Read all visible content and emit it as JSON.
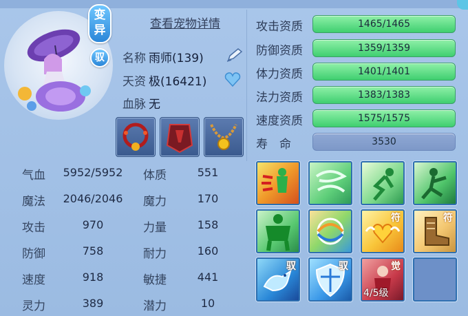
{
  "header": {
    "details_link": "查看宠物详情"
  },
  "badges": {
    "mutant": "变异",
    "tame": "驭"
  },
  "pet": {
    "name_label": "名称",
    "name_value": "雨师(139)",
    "aptitude_label": "天资",
    "aptitude_value": "极(16421)",
    "bloodline_label": "血脉",
    "bloodline_value": "无"
  },
  "qualities": [
    {
      "label": "攻击资质",
      "value": "1465/1465"
    },
    {
      "label": "防御资质",
      "value": "1359/1359"
    },
    {
      "label": "体力资质",
      "value": "1401/1401"
    },
    {
      "label": "法力资质",
      "value": "1383/1383"
    },
    {
      "label": "速度资质",
      "value": "1575/1575"
    }
  ],
  "lifespan": {
    "label": "寿　命",
    "value": "3530"
  },
  "stats": [
    {
      "label": "气血",
      "value": "5952/5952",
      "label2": "体质",
      "value2": "551"
    },
    {
      "label": "魔法",
      "value": "2046/2046",
      "label2": "魔力",
      "value2": "170"
    },
    {
      "label": "攻击",
      "value": "970",
      "label2": "力量",
      "value2": "158"
    },
    {
      "label": "防御",
      "value": "758",
      "label2": "耐力",
      "value2": "160"
    },
    {
      "label": "速度",
      "value": "918",
      "label2": "敏捷",
      "value2": "441"
    },
    {
      "label": "灵力",
      "value": "389",
      "label2": "潜力",
      "value2": "10"
    }
  ],
  "skills": {
    "tag_fu": "符",
    "tag_yu": "驭",
    "tag_jue": "觉",
    "level_text": "4/5级"
  },
  "colors": {
    "bar_green": "#4fd47c",
    "panel": "#a9c6ea",
    "skill_border": "#2e6fb0"
  }
}
